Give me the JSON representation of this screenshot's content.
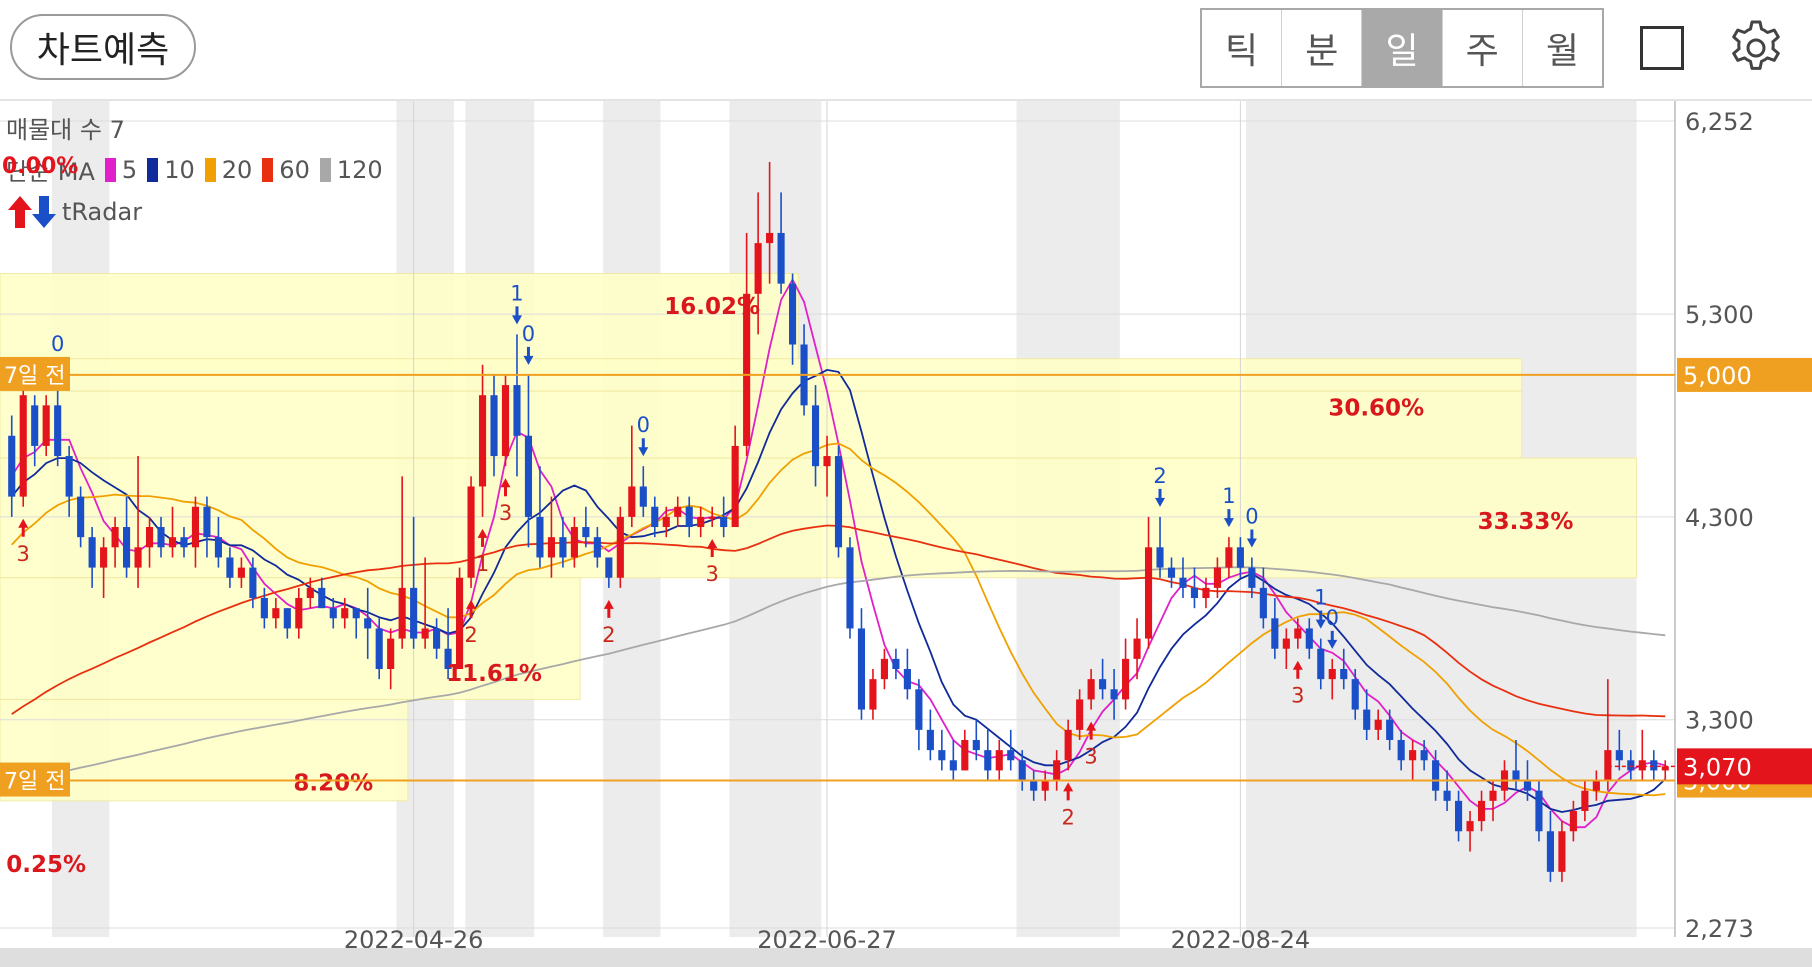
{
  "header": {
    "predict_button": "차트예측",
    "period_tabs": [
      {
        "label": "틱",
        "active": false
      },
      {
        "label": "분",
        "active": false
      },
      {
        "label": "일",
        "active": true
      },
      {
        "label": "주",
        "active": false
      },
      {
        "label": "월",
        "active": false
      }
    ],
    "icons": [
      "square-icon",
      "gear-icon"
    ]
  },
  "legend": {
    "volume_profile": "매물대 수 7",
    "ma_title": "단순 MA",
    "ma_items": [
      {
        "period": "5",
        "color": "#e020c8"
      },
      {
        "period": "10",
        "color": "#102a9a"
      },
      {
        "period": "20",
        "color": "#f0a000"
      },
      {
        "period": "60",
        "color": "#e83010"
      },
      {
        "period": "120",
        "color": "#a8a8a8"
      }
    ],
    "radar_label": "tRadar",
    "radar_pct": "0.00%"
  },
  "colors": {
    "up": "#e3141b",
    "down": "#1a4fc8",
    "zone": "#ffffc8",
    "level_line": "#f0a020",
    "price_badge": "#e3141b"
  },
  "chart_data": {
    "type": "candlestick",
    "ylim": [
      2273,
      6252
    ],
    "y_ticks": [
      6252,
      5300,
      4300,
      3300,
      2273
    ],
    "x_tick_labels": [
      {
        "label": "2022-04-26",
        "index": 35
      },
      {
        "label": "2022-06-27",
        "index": 71
      },
      {
        "label": "2022-08-24",
        "index": 107
      }
    ],
    "candles": [
      [
        4700,
        4800,
        4300,
        4400
      ],
      [
        4400,
        4950,
        4350,
        4900
      ],
      [
        4850,
        4900,
        4550,
        4650
      ],
      [
        4650,
        4900,
        4600,
        4850
      ],
      [
        4850,
        4950,
        4550,
        4600
      ],
      [
        4600,
        4650,
        4300,
        4400
      ],
      [
        4400,
        4450,
        4150,
        4200
      ],
      [
        4200,
        4250,
        3950,
        4050
      ],
      [
        4050,
        4200,
        3900,
        4150
      ],
      [
        4150,
        4300,
        4050,
        4250
      ],
      [
        4250,
        4400,
        4000,
        4050
      ],
      [
        4050,
        4600,
        3950,
        4150
      ],
      [
        4150,
        4300,
        4050,
        4250
      ],
      [
        4250,
        4300,
        4100,
        4150
      ],
      [
        4150,
        4350,
        4100,
        4200
      ],
      [
        4200,
        4250,
        4100,
        4150
      ],
      [
        4150,
        4400,
        4050,
        4350
      ],
      [
        4350,
        4400,
        4100,
        4200
      ],
      [
        4200,
        4300,
        4050,
        4100
      ],
      [
        4100,
        4150,
        3950,
        4000
      ],
      [
        4000,
        4100,
        3950,
        4050
      ],
      [
        4050,
        4100,
        3850,
        3900
      ],
      [
        3900,
        3950,
        3750,
        3800
      ],
      [
        3800,
        3900,
        3750,
        3850
      ],
      [
        3850,
        3850,
        3700,
        3750
      ],
      [
        3750,
        3950,
        3700,
        3900
      ],
      [
        3900,
        4000,
        3850,
        3950
      ],
      [
        3950,
        4000,
        3850,
        3850
      ],
      [
        3850,
        3900,
        3750,
        3800
      ],
      [
        3800,
        3900,
        3750,
        3850
      ],
      [
        3850,
        3850,
        3700,
        3800
      ],
      [
        3800,
        3950,
        3600,
        3750
      ],
      [
        3750,
        3800,
        3500,
        3550
      ],
      [
        3550,
        3750,
        3450,
        3700
      ],
      [
        3700,
        4500,
        3650,
        3950
      ],
      [
        3950,
        4300,
        3650,
        3700
      ],
      [
        3700,
        4100,
        3650,
        3750
      ],
      [
        3750,
        3800,
        3600,
        3650
      ],
      [
        3650,
        3850,
        3500,
        3550
      ],
      [
        3550,
        4050,
        3550,
        4000
      ],
      [
        4000,
        4500,
        3950,
        4450
      ],
      [
        4450,
        5050,
        4300,
        4900
      ],
      [
        4900,
        5000,
        4500,
        4600
      ],
      [
        4600,
        5000,
        4550,
        4950
      ],
      [
        4950,
        5200,
        4500,
        4700
      ],
      [
        4700,
        5000,
        4150,
        4300
      ],
      [
        4300,
        4550,
        4050,
        4100
      ],
      [
        4100,
        4400,
        4000,
        4200
      ],
      [
        4200,
        4300,
        4050,
        4100
      ],
      [
        4100,
        4300,
        4050,
        4250
      ],
      [
        4250,
        4350,
        4150,
        4200
      ],
      [
        4200,
        4250,
        4050,
        4100
      ],
      [
        4100,
        4100,
        3950,
        4000
      ],
      [
        4000,
        4350,
        3950,
        4300
      ],
      [
        4300,
        4750,
        4250,
        4450
      ],
      [
        4450,
        4550,
        4300,
        4350
      ],
      [
        4350,
        4400,
        4200,
        4250
      ],
      [
        4250,
        4350,
        4200,
        4300
      ],
      [
        4300,
        4400,
        4250,
        4350
      ],
      [
        4350,
        4400,
        4200,
        4250
      ],
      [
        4250,
        4350,
        4200,
        4300
      ],
      [
        4300,
        4350,
        4250,
        4300
      ],
      [
        4300,
        4400,
        4200,
        4250
      ],
      [
        4250,
        4750,
        4250,
        4650
      ],
      [
        4650,
        5700,
        4600,
        5400
      ],
      [
        5400,
        5900,
        5200,
        5650
      ],
      [
        5650,
        6050,
        5450,
        5700
      ],
      [
        5700,
        5900,
        5400,
        5450
      ],
      [
        5450,
        5500,
        5050,
        5150
      ],
      [
        5150,
        5250,
        4800,
        4850
      ],
      [
        4850,
        4950,
        4450,
        4550
      ],
      [
        4550,
        4700,
        4400,
        4600
      ],
      [
        4600,
        4650,
        4100,
        4150
      ],
      [
        4150,
        4200,
        3700,
        3750
      ],
      [
        3750,
        3850,
        3300,
        3350
      ],
      [
        3350,
        3550,
        3300,
        3500
      ],
      [
        3500,
        3650,
        3450,
        3600
      ],
      [
        3600,
        3650,
        3500,
        3550
      ],
      [
        3550,
        3650,
        3400,
        3450
      ],
      [
        3450,
        3500,
        3150,
        3250
      ],
      [
        3250,
        3350,
        3100,
        3150
      ],
      [
        3150,
        3250,
        3050,
        3100
      ],
      [
        3100,
        3200,
        3000,
        3050
      ],
      [
        3050,
        3250,
        3050,
        3200
      ],
      [
        3200,
        3300,
        3100,
        3150
      ],
      [
        3150,
        3250,
        3000,
        3050
      ],
      [
        3050,
        3200,
        3000,
        3150
      ],
      [
        3150,
        3250,
        3050,
        3100
      ],
      [
        3100,
        3150,
        2950,
        3000
      ],
      [
        3000,
        3050,
        2900,
        2950
      ],
      [
        2950,
        3050,
        2900,
        3000
      ],
      [
        3000,
        3150,
        2950,
        3100
      ],
      [
        3100,
        3300,
        3050,
        3250
      ],
      [
        3250,
        3450,
        3200,
        3400
      ],
      [
        3400,
        3550,
        3350,
        3500
      ],
      [
        3500,
        3600,
        3400,
        3450
      ],
      [
        3450,
        3550,
        3300,
        3400
      ],
      [
        3400,
        3700,
        3350,
        3600
      ],
      [
        3600,
        3800,
        3500,
        3700
      ],
      [
        3700,
        4300,
        3650,
        4150
      ],
      [
        4150,
        4300,
        4000,
        4050
      ],
      [
        4050,
        4100,
        3950,
        4000
      ],
      [
        4000,
        4100,
        3900,
        3950
      ],
      [
        3950,
        4050,
        3850,
        3900
      ],
      [
        3900,
        4000,
        3850,
        3950
      ],
      [
        3950,
        4100,
        3900,
        4050
      ],
      [
        4050,
        4200,
        4000,
        4150
      ],
      [
        4150,
        4200,
        4000,
        4050
      ],
      [
        4050,
        4100,
        3900,
        3950
      ],
      [
        3950,
        4050,
        3750,
        3800
      ],
      [
        3800,
        3900,
        3600,
        3650
      ],
      [
        3650,
        3750,
        3550,
        3700
      ],
      [
        3700,
        3800,
        3650,
        3750
      ],
      [
        3750,
        3800,
        3600,
        3650
      ],
      [
        3650,
        3700,
        3450,
        3500
      ],
      [
        3500,
        3600,
        3400,
        3550
      ],
      [
        3550,
        3650,
        3450,
        3500
      ],
      [
        3500,
        3550,
        3300,
        3350
      ],
      [
        3350,
        3450,
        3200,
        3250
      ],
      [
        3250,
        3350,
        3200,
        3300
      ],
      [
        3300,
        3350,
        3150,
        3200
      ],
      [
        3200,
        3250,
        3050,
        3100
      ],
      [
        3100,
        3200,
        3000,
        3150
      ],
      [
        3150,
        3200,
        3050,
        3100
      ],
      [
        3100,
        3150,
        2900,
        2950
      ],
      [
        2950,
        3050,
        2850,
        2900
      ],
      [
        2900,
        2950,
        2700,
        2750
      ],
      [
        2750,
        2850,
        2650,
        2800
      ],
      [
        2800,
        2950,
        2750,
        2900
      ],
      [
        2900,
        3000,
        2800,
        2950
      ],
      [
        2950,
        3100,
        2900,
        3050
      ],
      [
        3050,
        3200,
        2950,
        3000
      ],
      [
        3000,
        3100,
        2900,
        2950
      ],
      [
        2950,
        3000,
        2700,
        2750
      ],
      [
        2750,
        2850,
        2500,
        2550
      ],
      [
        2550,
        2800,
        2500,
        2750
      ],
      [
        2750,
        2900,
        2700,
        2850
      ],
      [
        2850,
        3000,
        2800,
        2950
      ],
      [
        2950,
        3050,
        2900,
        3000
      ],
      [
        3000,
        3500,
        2950,
        3150
      ],
      [
        3150,
        3250,
        3050,
        3100
      ],
      [
        3100,
        3150,
        3000,
        3050
      ],
      [
        3050,
        3250,
        3000,
        3100
      ],
      [
        3100,
        3150,
        3000,
        3050
      ],
      [
        3050,
        3100,
        3000,
        3070
      ]
    ],
    "ma_series": [
      {
        "period": 5,
        "color": "#e020c8"
      },
      {
        "period": 10,
        "color": "#102a9a"
      },
      {
        "period": 20,
        "color": "#f0a000"
      },
      {
        "period": 60,
        "color": "#e83010"
      },
      {
        "period": 120,
        "color": "#a8a8a8"
      }
    ],
    "ma_warmup": [
      4600,
      4550,
      4500,
      4450,
      4400,
      4350,
      4300,
      4250,
      4200,
      4150,
      4100,
      4050,
      4000,
      3950,
      3900,
      3850,
      3800,
      3750,
      3700,
      3650,
      3600,
      3550,
      3500,
      3450,
      3400,
      3350,
      3300,
      3250,
      3200,
      3150,
      3100,
      3050,
      3000,
      2950,
      2900,
      2850,
      2800,
      2780,
      2760,
      2740,
      2720,
      2700,
      2690,
      2680,
      2670,
      2660,
      2650,
      2640,
      2630,
      2620,
      2610,
      2600,
      2600,
      2600,
      2600,
      2600,
      2600,
      2600,
      2600,
      2600,
      2600,
      2600,
      2600,
      2600,
      2600,
      2600,
      2600,
      2600,
      2600,
      2600,
      2600,
      2600,
      2600,
      2600,
      2600,
      2600,
      2600,
      2600,
      2600,
      2600,
      2600,
      2600,
      2600,
      2600,
      2600,
      2600,
      2600,
      2600,
      2600,
      2600,
      2600,
      2600,
      2600,
      2600,
      2600,
      2600,
      2600,
      2600,
      2600,
      2600,
      2600,
      2600,
      2600,
      2600,
      2600,
      2600,
      2600,
      2600,
      2600,
      2600,
      2600,
      2600,
      2600,
      2600,
      2600,
      2600,
      2600,
      2600,
      2600,
      2600
    ],
    "gray_bands": [
      [
        4,
        8
      ],
      [
        34,
        38
      ],
      [
        40,
        45
      ],
      [
        52,
        56
      ],
      [
        63,
        70
      ],
      [
        88,
        96
      ],
      [
        108,
        141
      ]
    ],
    "zones": [
      {
        "from": 0,
        "to": 68,
        "top": 5500,
        "bottom": 5000
      },
      {
        "from": 0,
        "to": 131,
        "top": 5080,
        "bottom": 4920
      },
      {
        "from": 0,
        "to": 131,
        "top": 4920,
        "bottom": 4590
      },
      {
        "from": 0,
        "to": 141,
        "top": 4590,
        "bottom": 4000
      },
      {
        "from": 0,
        "to": 49,
        "top": 4000,
        "bottom": 3400
      },
      {
        "from": 0,
        "to": 34,
        "top": 3400,
        "bottom": 2900
      }
    ],
    "zone_labels": [
      {
        "text": "16.02%",
        "index": 61,
        "value": 5300
      },
      {
        "text": "30.60%",
        "index": 123,
        "value": 4800
      },
      {
        "text": "33.33%",
        "index": 136,
        "value": 4240
      },
      {
        "text": "11.61%",
        "index": 42,
        "value": 3490
      },
      {
        "text": "8.20%",
        "index": 28,
        "value": 2950
      },
      {
        "text": "0.25%",
        "index": 3,
        "value": 2550
      }
    ],
    "levels": [
      {
        "value": 5000,
        "label": "7일 전",
        "badge": "5,000"
      },
      {
        "value": 3000,
        "label": "7일 전",
        "badge": "3,000"
      }
    ],
    "current_price": {
      "value": 3070,
      "label": "3,070"
    },
    "signals": [
      {
        "index": 1,
        "type": "up",
        "label": "3"
      },
      {
        "index": 4,
        "type": "down",
        "label": "0"
      },
      {
        "index": 40,
        "type": "up",
        "label": "2"
      },
      {
        "index": 43,
        "type": "up",
        "label": "3"
      },
      {
        "index": 41,
        "type": "up",
        "label": "1"
      },
      {
        "index": 44,
        "type": "down",
        "label": "1"
      },
      {
        "index": 45,
        "type": "down",
        "label": "0"
      },
      {
        "index": 52,
        "type": "up",
        "label": "2"
      },
      {
        "index": 55,
        "type": "down",
        "label": "0"
      },
      {
        "index": 61,
        "type": "up",
        "label": "3"
      },
      {
        "index": 92,
        "type": "up",
        "label": "2"
      },
      {
        "index": 94,
        "type": "up",
        "label": "3"
      },
      {
        "index": 100,
        "type": "down",
        "label": "2"
      },
      {
        "index": 106,
        "type": "down",
        "label": "1"
      },
      {
        "index": 108,
        "type": "down",
        "label": "0"
      },
      {
        "index": 112,
        "type": "up",
        "label": "3"
      },
      {
        "index": 114,
        "type": "down",
        "label": "1"
      },
      {
        "index": 115,
        "type": "down",
        "label": "0"
      }
    ]
  }
}
